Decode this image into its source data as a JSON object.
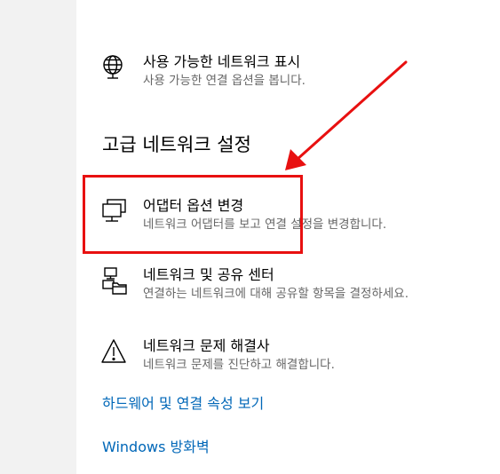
{
  "items": [
    {
      "title": "사용 가능한 네트워크 표시",
      "desc": "사용 가능한 연결 옵션을 봅니다.",
      "icon": "globe-network-icon"
    },
    {
      "title": "어댑터 옵션 변경",
      "desc": "네트워크 어댑터를 보고 연결 설정을 변경합니다.",
      "icon": "network-adapter-icon"
    },
    {
      "title": "네트워크 및 공유 센터",
      "desc": "연결하는 네트워크에 대해 공유할 항목을 결정하세요.",
      "icon": "sharing-center-icon"
    },
    {
      "title": "네트워크 문제 해결사",
      "desc": "네트워크 문제를 진단하고 해결합니다.",
      "icon": "warning-icon"
    }
  ],
  "section_heading": "고급 네트워크 설정",
  "links": {
    "hardware": "하드웨어 및 연결 속성 보기",
    "firewall": "Windows 방화벽"
  },
  "colors": {
    "link": "#0067b8",
    "annotation": "#e81010",
    "description": "#666666"
  }
}
